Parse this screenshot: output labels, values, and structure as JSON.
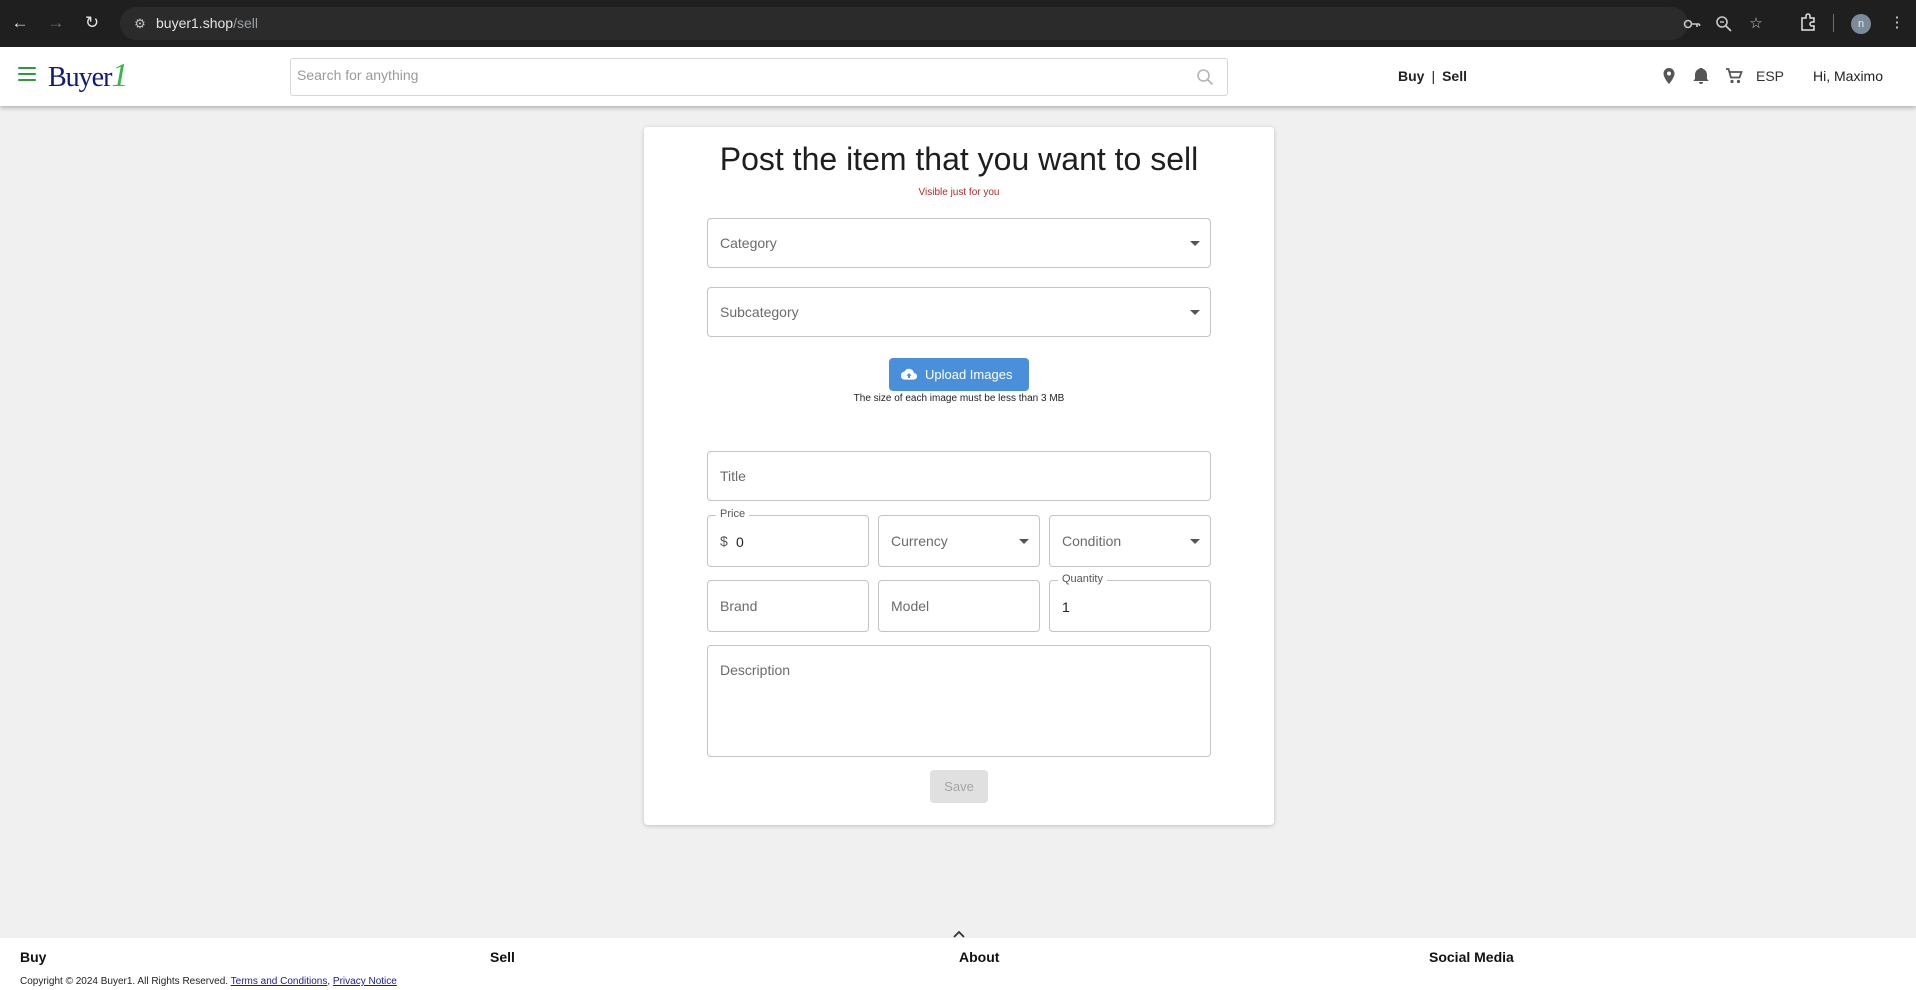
{
  "browser": {
    "url_host": "buyer1.shop",
    "url_path": "/sell",
    "profile_initial": "n"
  },
  "header": {
    "logo_main": "Buyer",
    "logo_accent": "1",
    "search_placeholder": "Search for anything",
    "buy_label": "Buy",
    "separator": "|",
    "sell_label": "Sell",
    "language": "ESP",
    "greeting": "Hi, Maximo"
  },
  "form": {
    "title": "Post the item that you want to sell",
    "visibility_note": "Visible just for you",
    "category_placeholder": "Category",
    "subcategory_placeholder": "Subcategory",
    "upload_label": "Upload Images",
    "upload_note": "The size of each image must be less than 3 MB",
    "title_placeholder": "Title",
    "price_label": "Price",
    "price_prefix": "$",
    "price_value": "0",
    "currency_placeholder": "Currency",
    "condition_placeholder": "Condition",
    "brand_placeholder": "Brand",
    "model_placeholder": "Model",
    "quantity_label": "Quantity",
    "quantity_value": "1",
    "description_placeholder": "Description",
    "save_label": "Save"
  },
  "footer": {
    "columns": [
      "Buy",
      "Sell",
      "About",
      "Social Media"
    ],
    "copyright": "Copyright © 2024 Buyer1. All Rights Reserved.",
    "terms_label": "Terms and Conditions",
    "comma": ",",
    "privacy_label": "Privacy Notice"
  },
  "colors": {
    "brand_blue": "#0f1a7a",
    "brand_green": "#37b84a",
    "upload_button": "#4a8fd9",
    "note_red": "#b02a2a"
  }
}
